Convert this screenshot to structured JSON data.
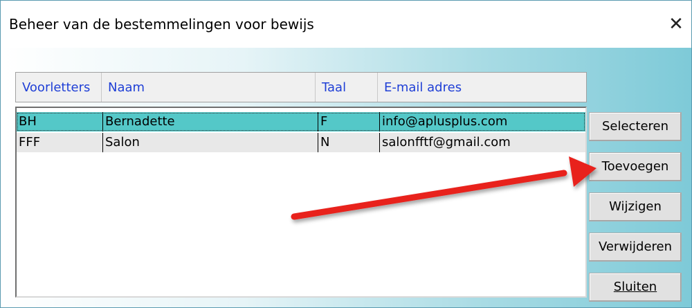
{
  "window": {
    "title": "Beheer van de bestemmelingen voor bewijs"
  },
  "table": {
    "columns": [
      "Voorletters",
      "Naam",
      "Taal",
      "E-mail adres"
    ],
    "rows": [
      {
        "voorletters": "BH",
        "naam": "Bernadette",
        "taal": "F",
        "email": "info@aplusplus.com"
      },
      {
        "voorletters": "FFF",
        "naam": "Salon",
        "taal": "N",
        "email": "salonfftf@gmail.com"
      }
    ]
  },
  "buttons": {
    "select": "Selecteren",
    "add": "Toevoegen",
    "edit": "Wijzigen",
    "delete": "Verwijderen",
    "close": "Sluiten"
  },
  "icons": {
    "close": "close-icon",
    "annotation": "red-arrow"
  },
  "colors": {
    "header_text": "#1f3fd6",
    "selected_row": "#54c8c8",
    "arrow": "#e8201e"
  }
}
